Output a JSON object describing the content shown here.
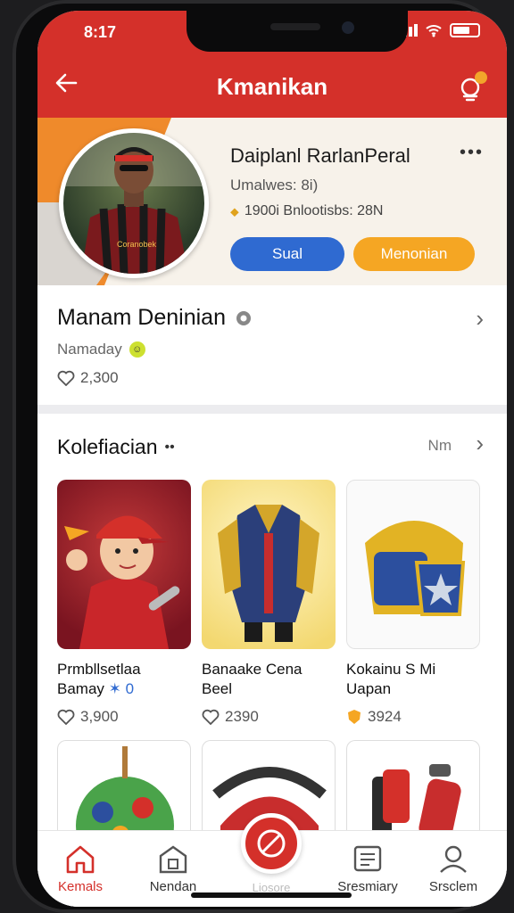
{
  "status": {
    "time": "8:17"
  },
  "header": {
    "title": "Kmanikan"
  },
  "profile": {
    "name": "Daiplanl RarlanPeral",
    "subtitle": "Umalwes: 8i)",
    "stat": "1900i Bnlootisbs: 28N",
    "primary_button": "Sual",
    "secondary_button": "Menonian"
  },
  "highlight": {
    "title": "Manam Deninian",
    "subtitle": "Namaday",
    "likes": "2,300"
  },
  "collection": {
    "title": "Kolefiacian",
    "more_label": "Nm",
    "items": [
      {
        "name_line1": "Prmbllsetlaa",
        "name_line2": "Bamay",
        "tag": "✶ 0",
        "likes": "3,900"
      },
      {
        "name_line1": "Banaake Cena",
        "name_line2": "Beel",
        "likes": "2390"
      },
      {
        "name_line1": "Kokainu S Mi",
        "name_line2": "Uapan",
        "likes": "3924"
      }
    ]
  },
  "nav": {
    "items": [
      "Kemals",
      "Nendan",
      "Sresmiary",
      "Srsclem"
    ],
    "center_label": "Liosore"
  },
  "colors": {
    "primary": "#d4302a",
    "accent": "#f5a623",
    "blue": "#2f6ad1"
  }
}
